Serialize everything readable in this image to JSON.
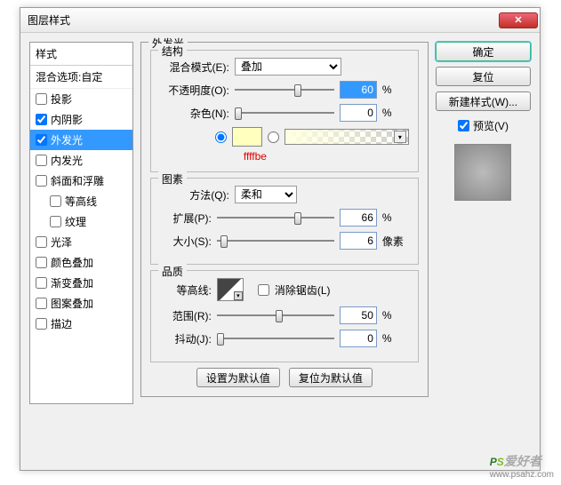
{
  "window": {
    "title": "图层样式"
  },
  "stylesPanel": {
    "header": "样式",
    "blendOptions": "混合选项:自定",
    "items": [
      {
        "label": "投影",
        "checked": false
      },
      {
        "label": "内阴影",
        "checked": true
      },
      {
        "label": "外发光",
        "checked": true,
        "selected": true
      },
      {
        "label": "内发光",
        "checked": false
      },
      {
        "label": "斜面和浮雕",
        "checked": false
      },
      {
        "label": "等高线",
        "checked": false,
        "indent": true
      },
      {
        "label": "纹理",
        "checked": false,
        "indent": true
      },
      {
        "label": "光泽",
        "checked": false
      },
      {
        "label": "颜色叠加",
        "checked": false
      },
      {
        "label": "渐变叠加",
        "checked": false
      },
      {
        "label": "图案叠加",
        "checked": false
      },
      {
        "label": "描边",
        "checked": false
      }
    ]
  },
  "panel": {
    "title": "外发光",
    "structure": {
      "legend": "结构",
      "blendMode": {
        "label": "混合模式(E):",
        "value": "叠加"
      },
      "opacity": {
        "label": "不透明度(O):",
        "value": "60",
        "unit": "%",
        "pos": 60
      },
      "noise": {
        "label": "杂色(N):",
        "value": "0",
        "unit": "%",
        "pos": 0
      },
      "colorHex": "ffffbe",
      "swatchColor": "#ffffbe"
    },
    "elements": {
      "legend": "图素",
      "technique": {
        "label": "方法(Q):",
        "value": "柔和"
      },
      "spread": {
        "label": "扩展(P):",
        "value": "66",
        "unit": "%",
        "pos": 66
      },
      "size": {
        "label": "大小(S):",
        "value": "6",
        "unit": "像素",
        "pos": 3
      }
    },
    "quality": {
      "legend": "品质",
      "contourLabel": "等高线:",
      "antialias": "消除锯齿(L)",
      "range": {
        "label": "范围(R):",
        "value": "50",
        "unit": "%",
        "pos": 50
      },
      "jitter": {
        "label": "抖动(J):",
        "value": "0",
        "unit": "%",
        "pos": 0
      }
    },
    "buttons": {
      "setDefault": "设置为默认值",
      "resetDefault": "复位为默认值"
    }
  },
  "right": {
    "ok": "确定",
    "cancel": "复位",
    "newStyle": "新建样式(W)...",
    "preview": "预览(V)"
  },
  "watermark": {
    "brand1": "P",
    "brand2": "S",
    "cn": "爱好者",
    "url": "www.psahz.com"
  }
}
